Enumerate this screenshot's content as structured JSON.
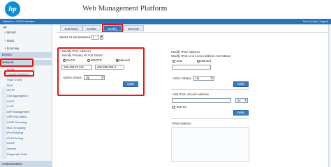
{
  "header": {
    "logo_text": "hp",
    "title": "Web Management Platform",
    "links": "Save | Help | Logout"
  },
  "breadcrumb": "Network > VLAN Interface",
  "sidebar": {
    "top_items": [
      "HP",
      "Wizard",
      "Stack",
      "Summary"
    ],
    "device_label": "Device",
    "network_label": "Network",
    "network_items": [
      "VLAN",
      "VLAN Interface",
      "Voice VLAN",
      "MAC",
      "MSTP",
      "Link Aggregation",
      "LACP",
      "LLDP",
      "ARP Management",
      "ARP Anti-Attack",
      "IGMP Snooping",
      "MLD Snooping",
      "IPv4 Routing",
      "IPv6 Routing",
      "DHCP",
      "Service",
      "Diagnostic Tools"
    ],
    "selected_item": "VLAN Interface",
    "authentication_label": "Authentication"
  },
  "tabs": [
    {
      "label": "Summary",
      "active": false
    },
    {
      "label": "Create",
      "active": false
    },
    {
      "label": "Modify",
      "active": true
    },
    {
      "label": "Remove",
      "active": false
    }
  ],
  "vlan_select": {
    "label": "Select VLAN Interface:",
    "value": "1"
  },
  "ipv4": {
    "title": "Modify IPv4 Address",
    "subtitle": "Modify Primary IP And Status",
    "options": [
      {
        "label": "DHCP",
        "checked": false
      },
      {
        "label": "BOOTP",
        "checked": false
      },
      {
        "label": "Manual",
        "checked": true
      }
    ],
    "ip_value": "192.168.37.221",
    "mask_value": "255.255.255.0",
    "admin_status_label": "Admin Status",
    "admin_status_value": "Up",
    "apply_label": "Apply"
  },
  "ipv6": {
    "title": "Modify IPv6 Address",
    "subtitle": "Modify IPv6 Link Local Address And Status",
    "options": [
      {
        "label": "Auto",
        "checked": false
      },
      {
        "label": "Manual",
        "checked": false
      }
    ],
    "admin_status_label": "Admin Status",
    "admin_status_value": "Up",
    "apply_label": "Apply",
    "unicast_title": "Add IPv6 Unicast Address",
    "prefix_value": "64",
    "eui_label": "EUI-64",
    "apply2_label": "Apply",
    "list_title": "IPv6 Address"
  },
  "colors": {
    "accent": "#2f74bd",
    "annotation_red": "#e11111"
  }
}
